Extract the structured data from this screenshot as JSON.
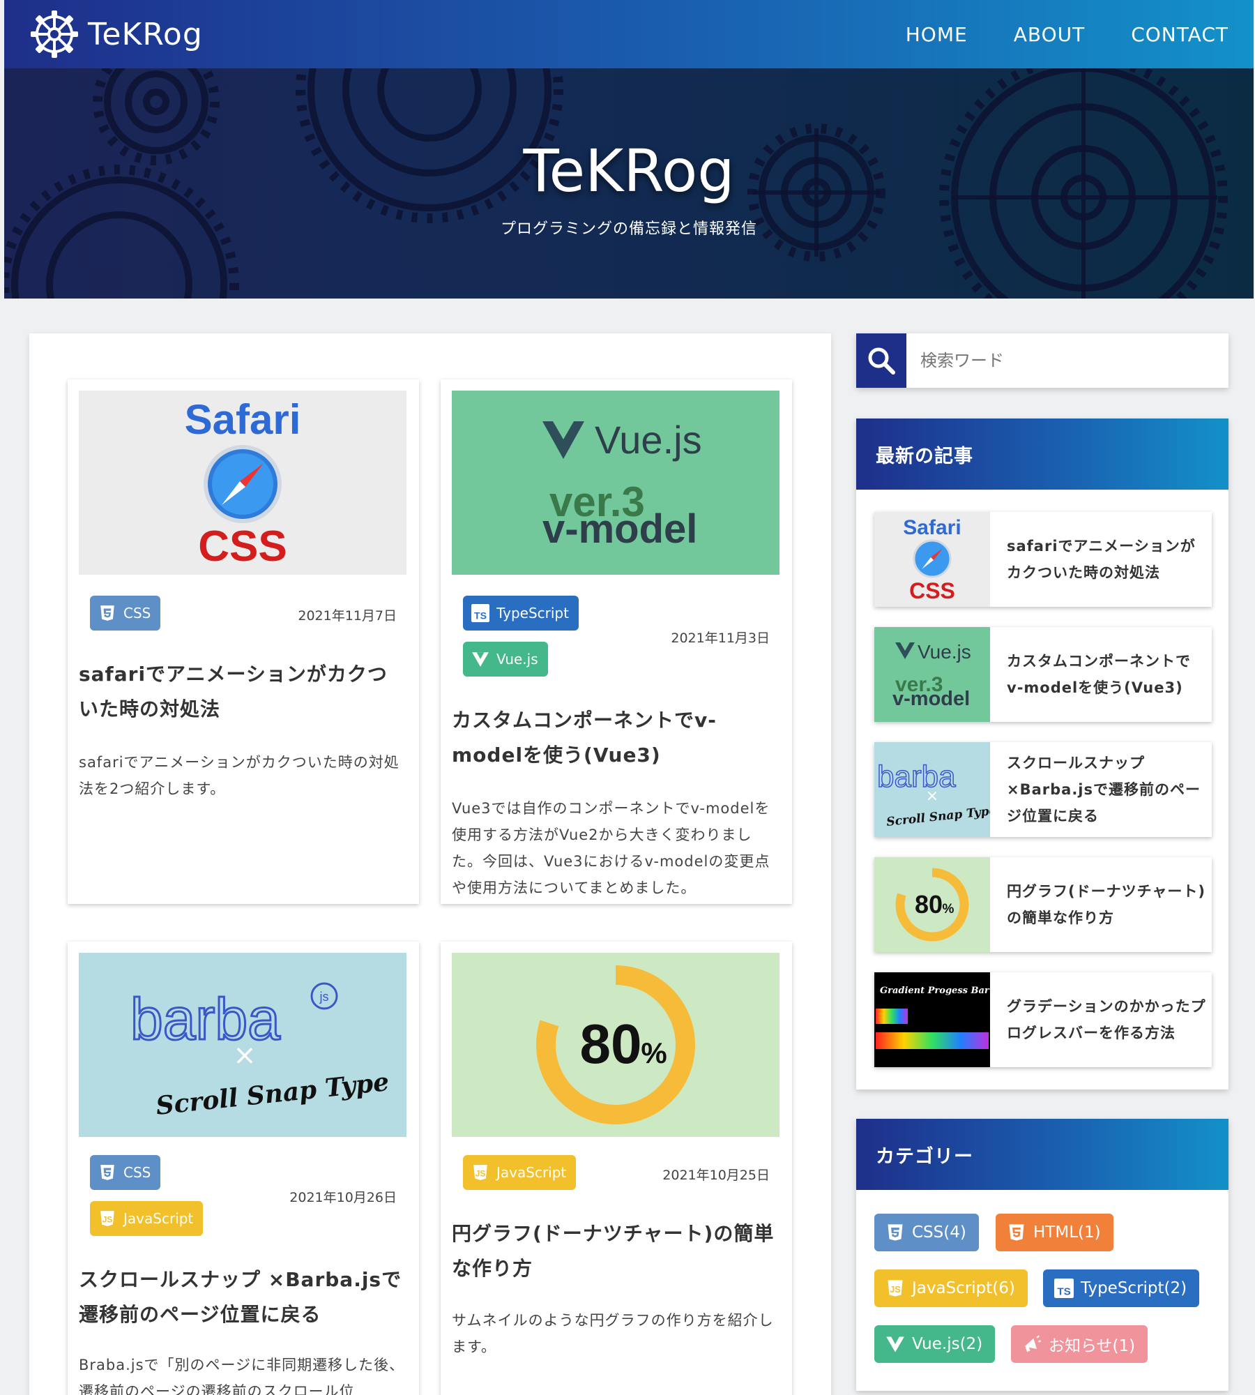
{
  "site": {
    "logo_text": "TeKRog",
    "nav": [
      "HOME",
      "ABOUT",
      "CONTACT"
    ]
  },
  "hero": {
    "title": "TeKRog",
    "subtitle": "プログラミングの備忘録と情報発信"
  },
  "posts": [
    {
      "thumb_text": [
        "Safari",
        "CSS"
      ],
      "tags": [
        "CSS"
      ],
      "date": "2021年11月7日",
      "title": "safariでアニメーションがカクついた時の対処法",
      "desc": "safariでアニメーションがカクついた時の対処法を2つ紹介します。"
    },
    {
      "thumb_text": [
        "Vue.js",
        "ver.3",
        "v-model"
      ],
      "tags": [
        "TypeScript",
        "Vue.js"
      ],
      "date": "2021年11月3日",
      "title": "カスタムコンポーネントでv-modelを使う(Vue3)",
      "desc": "Vue3では自作のコンポーネントでv-modelを使用する方法がVue2から大きく変わりました。今回は、Vue3におけるv-modelの変更点や使用方法についてまとめました。"
    },
    {
      "thumb_text": [
        "barba",
        "js",
        "×",
        "Scroll Snap Type"
      ],
      "tags": [
        "CSS",
        "JavaScript"
      ],
      "date": "2021年10月26日",
      "title": "スクロールスナップ ×Barba.jsで遷移前のページ位置に戻る",
      "desc": "Braba.jsで「別のページに非同期遷移した後、遷移前のページの遷移前のスクロール位"
    },
    {
      "thumb_text": [
        "80",
        "%"
      ],
      "tags": [
        "JavaScript"
      ],
      "date": "2021年10月25日",
      "title": "円グラフ(ドーナツチャート)の簡単な作り方",
      "desc": "サムネイルのような円グラフの作り方を紹介します。"
    }
  ],
  "sidebar": {
    "search_placeholder": "検索ワード",
    "recent_heading": "最新の記事",
    "recent": [
      "safariでアニメーションがカクついた時の対処法",
      "カスタムコンポーネントでv-modelを使う(Vue3)",
      "スクロールスナップ ×Barba.jsで遷移前のページ位置に戻る",
      "円グラフ(ドーナツチャート)の簡単な作り方",
      "グラデーションのかかったプログレスバーを作る方法"
    ],
    "recent_thumb_text": {
      "gradient": "Gradient Progess Bar"
    },
    "category_heading": "カテゴリー",
    "categories": [
      "CSS(4)",
      "HTML(1)",
      "JavaScript(6)",
      "TypeScript(2)",
      "Vue.js(2)",
      "お知らせ(1)"
    ]
  },
  "colors": {
    "nav_gradient": [
      "#1e2f8a",
      "#1391c8"
    ],
    "css": "#5e8fc7",
    "typescript": "#2a6ec2",
    "vue": "#44b88a",
    "javascript": "#f2c02b",
    "html": "#f0803a",
    "news": "#f0939a"
  },
  "icons": [
    "gear-logo-icon",
    "search-icon",
    "css3-icon",
    "typescript-icon",
    "vue-icon",
    "javascript-icon",
    "html5-icon",
    "megaphone-icon"
  ]
}
